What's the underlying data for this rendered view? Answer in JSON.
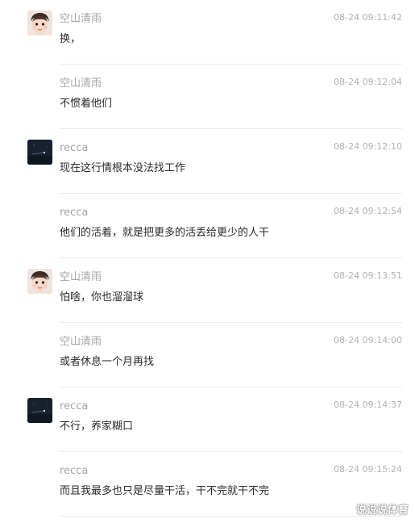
{
  "messages": [
    {
      "user": "空山清雨",
      "time": "08-24 09:11:42",
      "text": "换，",
      "avatar": "baby-avatar"
    },
    {
      "user": "空山清雨",
      "time": "08-24 09:12:04",
      "text": "不惯着他们",
      "avatar": null
    },
    {
      "user": "recca",
      "time": "08-24 09:12:10",
      "text": "现在这行情根本没法找工作",
      "avatar": "night-sky-avatar"
    },
    {
      "user": "recca",
      "time": "08-24 09:12:54",
      "text": "他们的活着，就是把更多的活丢给更少的人干",
      "avatar": null
    },
    {
      "user": "空山清雨",
      "time": "08-24 09:13:51",
      "text": "怕啥，你也溜溜球",
      "avatar": "baby-avatar"
    },
    {
      "user": "空山清雨",
      "time": "08-24 09:14:00",
      "text": "或者休息一个月再找",
      "avatar": null
    },
    {
      "user": "recca",
      "time": "08-24 09:14:37",
      "text": "不行，养家糊口",
      "avatar": "night-sky-avatar"
    },
    {
      "user": "recca",
      "time": "08-24 09:15:24",
      "text": "而且我最多也只是尽量干活，干不完就干不完",
      "avatar": null
    }
  ],
  "watermark": "说说说体育"
}
